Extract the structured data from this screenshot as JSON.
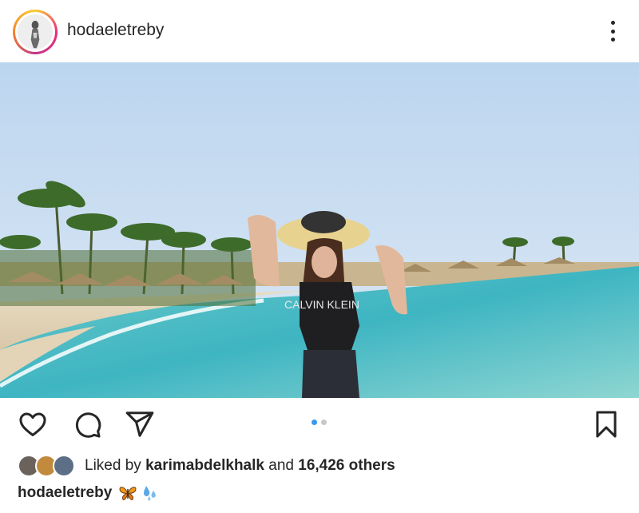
{
  "post": {
    "username": "hodaeletreby",
    "photo_text": "CALVIN KLEIN",
    "carousel": {
      "count": 2,
      "active_index": 0
    },
    "likes": {
      "prefix": "Liked by",
      "liked_by_user": "karimabdelkhalk",
      "connector": "and",
      "others": "16,426 others"
    },
    "caption": {
      "username": "hodaeletreby",
      "emojis": [
        "butterfly-emoji",
        "sweat-droplets-emoji"
      ]
    }
  },
  "icons": {
    "more": "more-options-icon",
    "like": "heart-icon",
    "comment": "comment-bubble-icon",
    "share": "paper-plane-icon",
    "save": "bookmark-icon"
  },
  "colors": {
    "text": "#262626",
    "carousel_active": "#3897f0",
    "carousel_inactive": "#c7c7c7"
  }
}
